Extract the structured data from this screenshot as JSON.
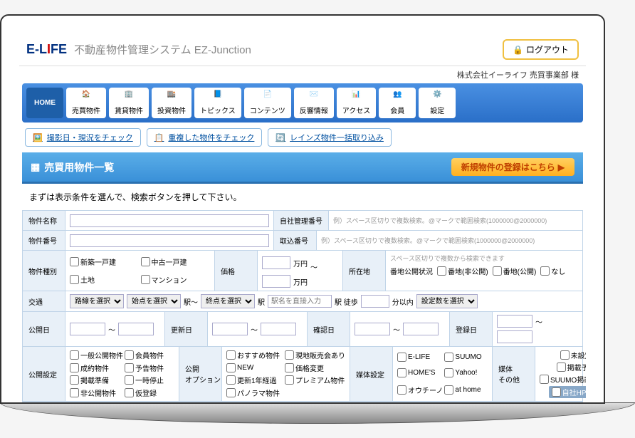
{
  "header": {
    "logo_main": "E-L",
    "logo_accent": "I",
    "logo_end": "FE",
    "system_title": "不動産物件管理システム EZ-Junction",
    "logout": "ログアウト",
    "company": "株式会社イーライフ 売買事業部 様"
  },
  "nav": [
    "HOME",
    "売買物件",
    "賃貸物件",
    "投資物件",
    "トピックス",
    "コンテンツ",
    "反響情報",
    "アクセス",
    "会員",
    "設定"
  ],
  "subnav": [
    "撮影日・現況をチェック",
    "重複した物件をチェック",
    "レインズ物件一括取り込み"
  ],
  "section": {
    "title": "売買用物件一覧",
    "new_reg": "新規物件の登録はこちら"
  },
  "instruction": "まずは表示条件を選んで、検索ボタンを押して下さい。",
  "labels": {
    "name": "物件名称",
    "self_num": "自社管理番号",
    "prop_num": "物件番号",
    "trade_num": "取込番号",
    "type": "物件種別",
    "price": "価格",
    "location": "所在地",
    "transit": "交通",
    "walk": "駅 徒歩",
    "open_date": "公開日",
    "update_date": "更新日",
    "confirm_date": "確認日",
    "reg_date": "登録日",
    "pub_setting": "公開設定",
    "pub_option": "公開\nオプション",
    "media": "媒体設定",
    "media_other": "媒体\nその他"
  },
  "placeholders": {
    "multi": "例）スペース区切りで複数検索。@マークで範囲検索(1000000@2000000)",
    "loc": "スペース区切りで複数から検索できます",
    "station": "駅名を直接入力"
  },
  "types": [
    "新築一戸建",
    "中古一戸建",
    "土地",
    "マンション"
  ],
  "price_unit": "万円",
  "land_pub": "番地公開状況",
  "land_opts": [
    "番地(非公開)",
    "番地(公開)",
    "なし"
  ],
  "selects": {
    "route": "路線を選択",
    "start": "始点を選択",
    "end": "終点を選択",
    "within": "分以内",
    "count": "設定数を選択"
  },
  "pub_set": [
    "一般公開物件",
    "会員物件",
    "成約物件",
    "予告物件",
    "掲載準備",
    "一時停止",
    "非公開物件",
    "仮登録"
  ],
  "pub_opt": [
    "おすすめ物件",
    "現地販売会あり",
    "NEW",
    "価格変更",
    "更新1年経過",
    "プレミアム物件",
    "パノラマ物件"
  ],
  "media_list": [
    "E-LIFE",
    "SUUMO",
    "HOME'S",
    "Yahoo!",
    "オウチーノ",
    "at home"
  ],
  "media_other": [
    "未設定",
    "掲載予備",
    "SUUMO掲載指示無",
    "自社HPのみ"
  ]
}
